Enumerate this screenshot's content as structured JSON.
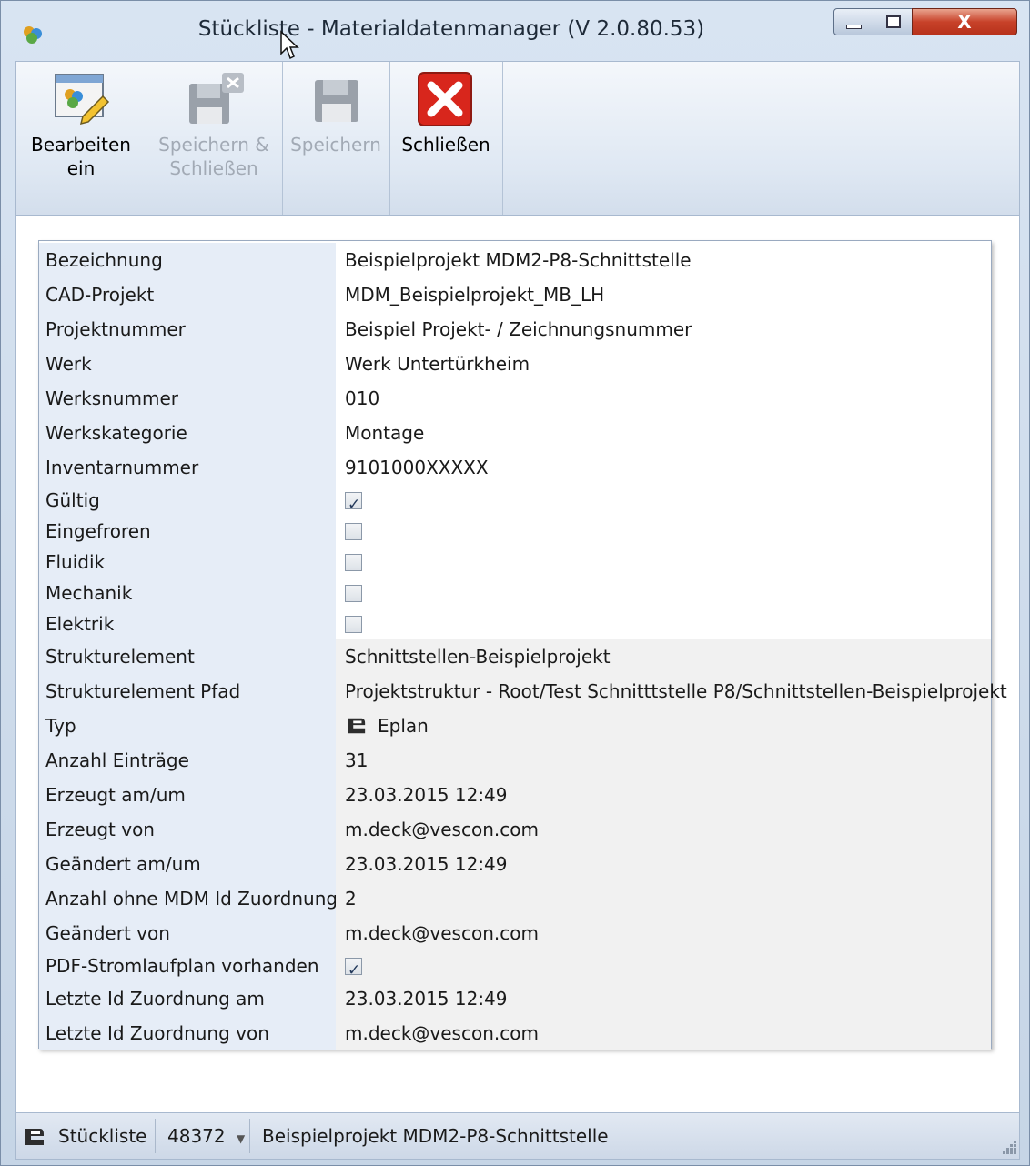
{
  "window": {
    "title": "Stückliste - Materialdatenmanager (V 2.0.80.53)",
    "close_glyph": "X"
  },
  "toolbar": {
    "edit_label": "Bearbeiten ein",
    "edit_line1": "Bearbeiten",
    "edit_line2": "ein",
    "save_close_line1": "Speichern &",
    "save_close_line2": "Schließen",
    "save_label": "Speichern",
    "close_label": "Schließen"
  },
  "properties": [
    {
      "label": "Bezeichnung",
      "value": "Beispielprojekt MDM2-P8-Schnittstelle"
    },
    {
      "label": "CAD-Projekt",
      "value": "MDM_Beispielprojekt_MB_LH"
    },
    {
      "label": "Projektnummer",
      "value": "Beispiel Projekt- / Zeichnungsnummer"
    },
    {
      "label": "Werk",
      "value": "Werk Untertürkheim"
    },
    {
      "label": "Werksnummer",
      "value": "010"
    },
    {
      "label": "Werkskategorie",
      "value": "Montage"
    },
    {
      "label": "Inventarnummer",
      "value": "9101000XXXXX"
    },
    {
      "label": "Gültig",
      "checked": true
    },
    {
      "label": "Eingefroren",
      "checked": false
    },
    {
      "label": "Fluidik",
      "checked": false
    },
    {
      "label": "Mechanik",
      "checked": false
    },
    {
      "label": "Elektrik",
      "checked": false
    },
    {
      "label": "Strukturelement",
      "value": "Schnittstellen-Beispielprojekt"
    },
    {
      "label": "Strukturelement Pfad",
      "value": "Projektstruktur - Root/Test Schnitttstelle P8/Schnittstellen-Beispielprojekt"
    },
    {
      "label": "Typ",
      "value": "Eplan",
      "icon": "eplan-icon"
    },
    {
      "label": "Anzahl Einträge",
      "value": "31"
    },
    {
      "label": "Erzeugt am/um",
      "value": "23.03.2015 12:49"
    },
    {
      "label": "Erzeugt von",
      "value": "m.deck@vescon.com"
    },
    {
      "label": "Geändert am/um",
      "value": "23.03.2015 12:49"
    },
    {
      "label": "Anzahl ohne MDM Id Zuordnung",
      "value": "2"
    },
    {
      "label": "Geändert von",
      "value": "m.deck@vescon.com"
    },
    {
      "label": "PDF-Stromlaufplan vorhanden",
      "checked": true
    },
    {
      "label": "Letzte Id Zuordnung am",
      "value": "23.03.2015 12:49"
    },
    {
      "label": "Letzte Id Zuordnung von",
      "value": "m.deck@vescon.com"
    }
  ],
  "statusbar": {
    "doc_type": "Stückliste",
    "doc_id": "48372",
    "doc_name": "Beispielprojekt MDM2-P8-Schnittstelle"
  },
  "colors": {
    "label_column": "#e6edf7",
    "readonly_value": "#f1f1f1",
    "close_red": "#d8261c"
  }
}
